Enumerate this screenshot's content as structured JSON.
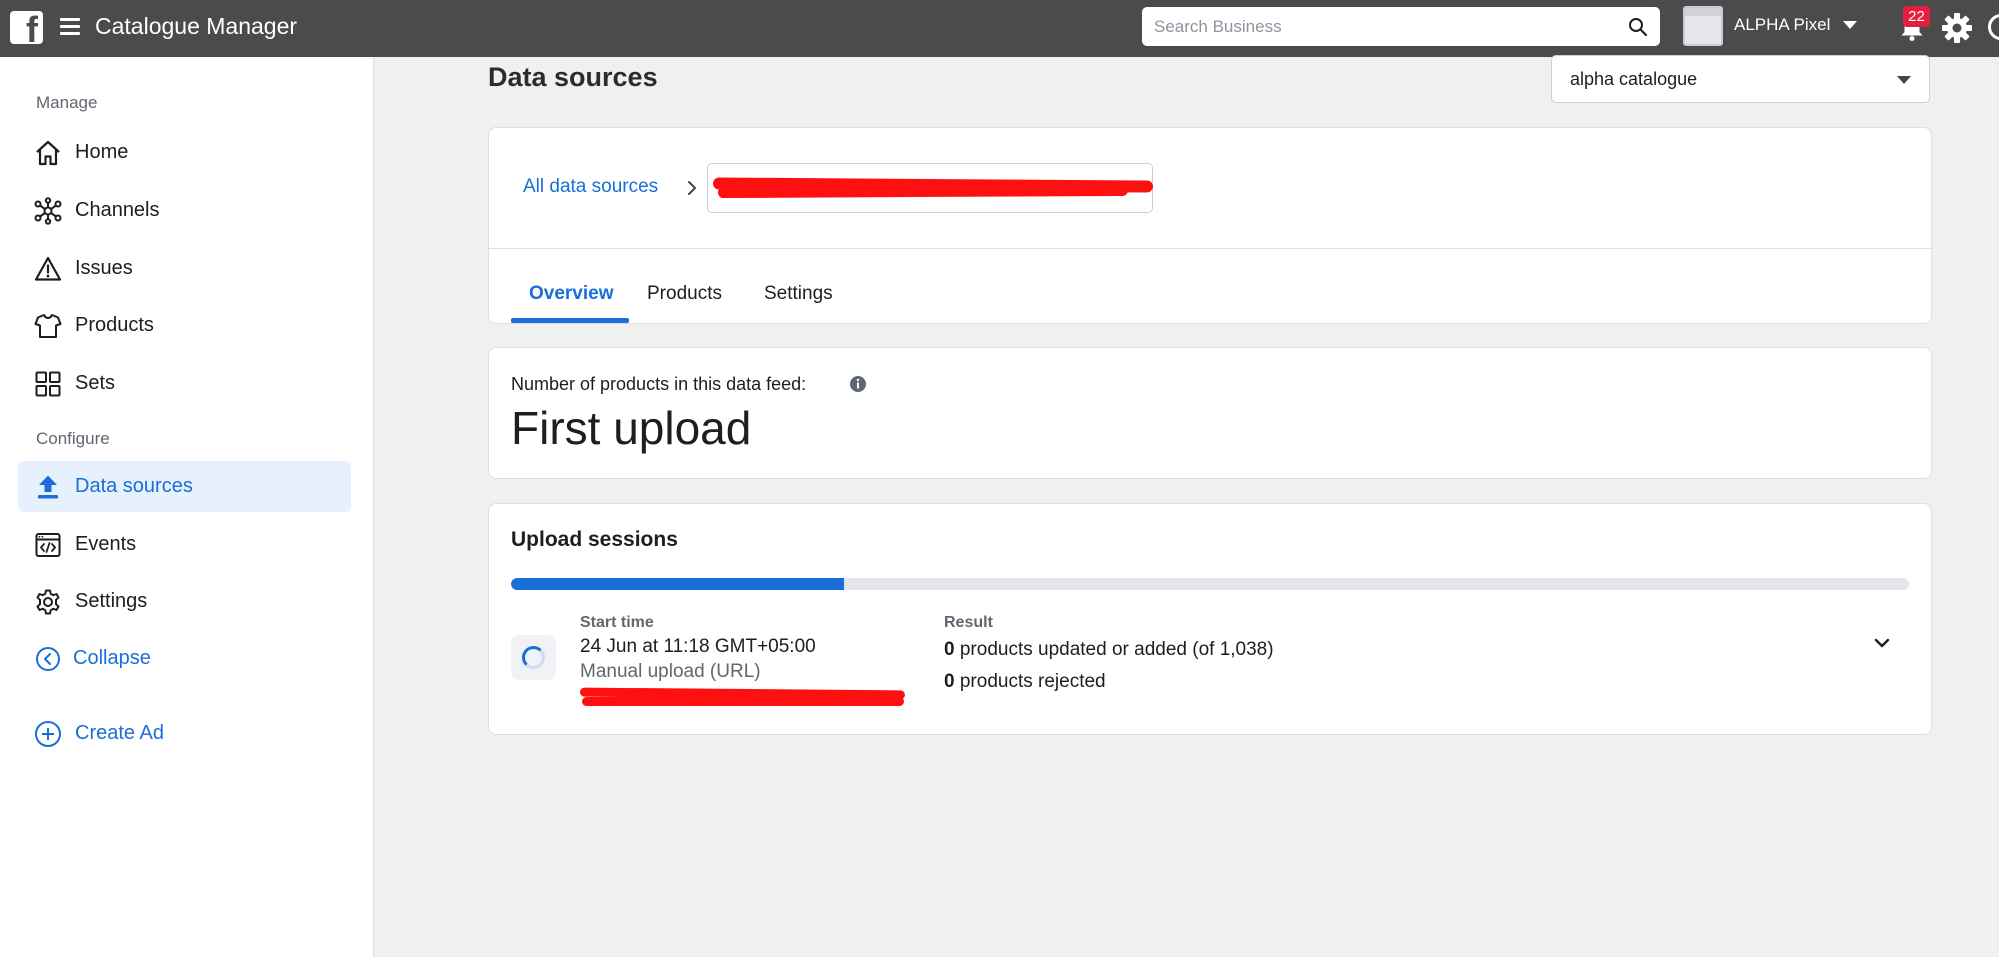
{
  "topbar": {
    "app_title": "Catalogue Manager",
    "search_placeholder": "Search Business",
    "business_name": "ALPHA Pixel",
    "notification_count": "22"
  },
  "sidebar": {
    "manage_label": "Manage",
    "configure_label": "Configure",
    "items": [
      {
        "label": "Home",
        "icon": "home-icon"
      },
      {
        "label": "Channels",
        "icon": "channels-icon"
      },
      {
        "label": "Issues",
        "icon": "warning-icon"
      },
      {
        "label": "Products",
        "icon": "shirt-icon"
      },
      {
        "label": "Sets",
        "icon": "grid-icon"
      },
      {
        "label": "Data sources",
        "icon": "upload-icon"
      },
      {
        "label": "Events",
        "icon": "code-window-icon"
      },
      {
        "label": "Settings",
        "icon": "gear-icon"
      }
    ],
    "collapse_label": "Collapse",
    "create_ad_label": "Create Ad",
    "active_item": "Data sources"
  },
  "main": {
    "page_title": "Data sources",
    "catalog_select_value": "alpha catalogue",
    "breadcrumb_link": "All data sources",
    "tabs": [
      {
        "label": "Overview",
        "active": true
      },
      {
        "label": "Products",
        "active": false
      },
      {
        "label": "Settings",
        "active": false
      }
    ],
    "feed_label": "Number of products in this data feed:",
    "feed_value": "First upload",
    "sessions": {
      "title": "Upload sessions",
      "progress_fraction": 0.238,
      "start_time_label": "Start time",
      "start_time": "24 Jun at 11:18 GMT+05:00",
      "method": "Manual upload (URL)",
      "result_label": "Result",
      "updated_count": "0",
      "updated_text": " products updated or added (of 1,038)",
      "rejected_count": "0",
      "rejected_text": " products rejected"
    }
  },
  "colors": {
    "topbar": "#4b4b4b",
    "accent": "#1a6ed8",
    "redaction": "#ff1010",
    "badge": "#e41e3f"
  }
}
